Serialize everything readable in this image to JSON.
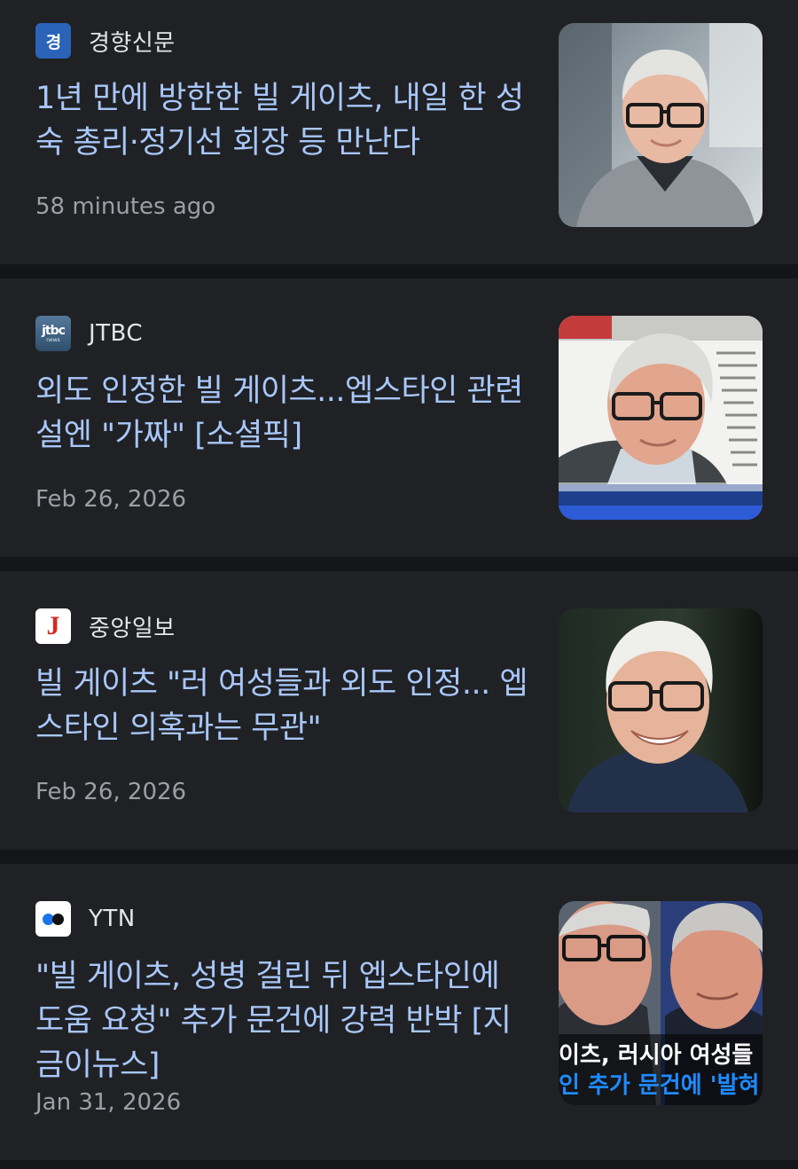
{
  "articles": [
    {
      "source": "경향신문",
      "logo_text": "경",
      "headline": "1년 만에 방한한 빌 게이츠, 내일 한 성숙 총리·정기선 회장 등 만난다",
      "time": "58 minutes ago"
    },
    {
      "source": "JTBC",
      "logo_text": "jtbc",
      "logo_subtext": "news",
      "headline": "외도 인정한 빌 게이츠...엡스타인 관련설엔 \"가짜\" [소셜픽]",
      "time": "Feb 26, 2026"
    },
    {
      "source": "중앙일보",
      "logo_text": "J",
      "headline": "빌 게이츠 \"러 여성들과 외도 인정... 엡스타인 의혹과는 무관\"",
      "time": "Feb 26, 2026"
    },
    {
      "source": "YTN",
      "headline": "\"빌 게이츠, 성병 걸린 뒤 엡스타인에 도움 요청\" 추가 문건에 강력 반박 [지금이뉴스]",
      "time": "Jan 31, 2026",
      "thumb_caption_1": "이츠, 러시아 여성들",
      "thumb_caption_2": "인 추가 문건에 '발혀"
    }
  ],
  "colors": {
    "page_bg": "#141519",
    "card_bg": "#202124",
    "headline": "#a8c7fa",
    "source_text": "#e4e5e8",
    "time_text": "#9aa0a6",
    "ytn_caption_1": "#ffffff",
    "ytn_caption_2": "#1e8bff"
  }
}
